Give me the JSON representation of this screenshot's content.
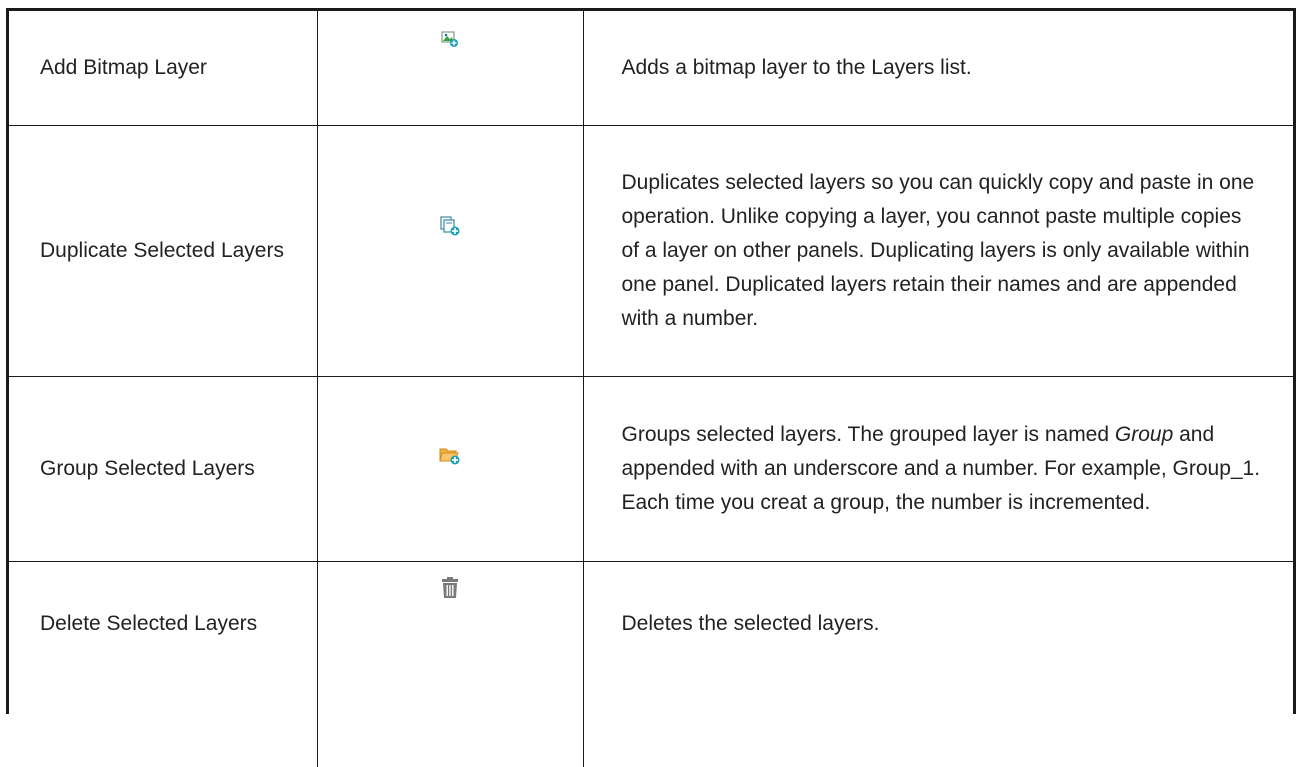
{
  "rows": [
    {
      "name": "Add Bitmap Layer",
      "icon": "add-bitmap-layer-icon",
      "description": "Adds a bitmap layer to the Layers list."
    },
    {
      "name": "Duplicate Selected Layers",
      "icon": "duplicate-layers-icon",
      "description": "Duplicates selected layers so you can quickly copy and paste in one operation. Unlike copying a layer, you cannot paste multiple copies of a layer on other panels. Duplicating layers is only available within one panel. Duplicated layers retain their names and are appended with a number."
    },
    {
      "name": "Group Selected Layers",
      "icon": "group-layers-icon",
      "description_before": "Groups selected layers. The grouped layer is named ",
      "description_em": "Group",
      "description_after": " and appended with an underscore and a number. For example, Group_1. Each time you creat a group, the number is incremented."
    },
    {
      "name": "Delete Selected Layers",
      "icon": "trash-icon",
      "description": "Deletes the selected layers."
    }
  ],
  "colors": {
    "border": "#1a1a1a",
    "text": "#222222",
    "icon_teal": "#1a9fb5",
    "icon_folder": "#f0a030",
    "icon_green": "#3aa040",
    "icon_gray": "#7a7a7a"
  }
}
